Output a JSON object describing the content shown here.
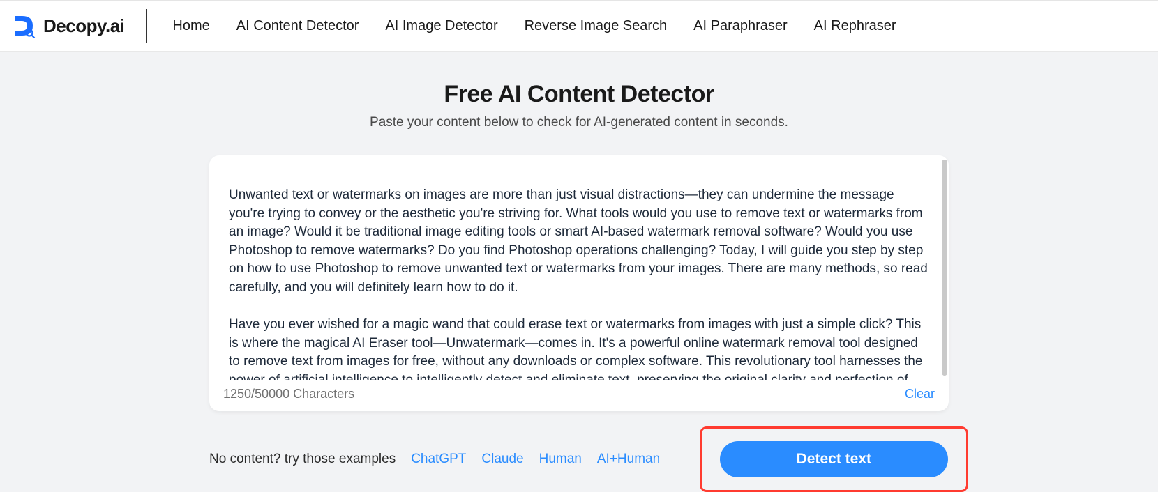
{
  "brand": "Decopy.ai",
  "nav": {
    "items": [
      "Home",
      "AI Content Detector",
      "AI Image Detector",
      "Reverse Image Search",
      "AI Paraphraser",
      "AI Rephraser"
    ]
  },
  "page": {
    "title": "Free AI Content Detector",
    "subtitle": "Paste your content below to check for AI-generated content in seconds."
  },
  "editor": {
    "content": "Unwanted text or watermarks on images are more than just visual distractions—they can undermine the message you're trying to convey or the aesthetic you're striving for. What tools would you use to remove text or watermarks from an image? Would it be traditional image editing tools or smart AI-based watermark removal software? Would you use Photoshop to remove watermarks? Do you find Photoshop operations challenging? Today, I will guide you step by step on how to use Photoshop to remove unwanted text or watermarks from your images. There are many methods, so read carefully, and you will definitely learn how to do it.\n\nHave you ever wished for a magic wand that could erase text or watermarks from images with just a simple click? This is where the magical AI Eraser tool—Unwatermark—comes in. It's a powerful online watermark removal tool designed to remove text from images for free, without any downloads or complex software. This revolutionary tool harnesses the power of artificial intelligence to intelligently detect and eliminate text, preserving the original clarity and perfection of your images. By using smart AI-based watermark removal tools, removing text or watermarks from images no longer has to be a source of frustration",
    "char_count": "1250/50000 Characters",
    "clear_label": "Clear"
  },
  "examples": {
    "label": "No content? try those examples",
    "items": [
      "ChatGPT",
      "Claude",
      "Human",
      "AI+Human"
    ]
  },
  "detect": {
    "label": "Detect text"
  }
}
